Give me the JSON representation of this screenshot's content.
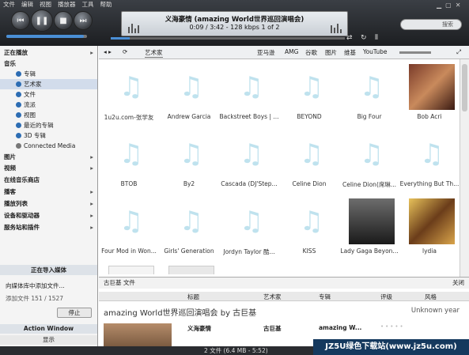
{
  "menu": [
    "文件",
    "编辑",
    "视图",
    "播放器",
    "工具",
    "帮助"
  ],
  "now_playing": {
    "title": "义海豪情 (amazing World世界巡回演唱会)",
    "info": "0:09 / 3:42 - 128 kbps  1 of 2"
  },
  "search_placeholder": "搜索",
  "sidebar": {
    "now_playing": "正在播放",
    "music": "音乐",
    "music_items": [
      "专辑",
      "艺术家",
      "文件",
      "流派",
      "视图",
      "最近的专辑",
      "3D 专辑",
      "Connected Media"
    ],
    "sections": [
      "图片",
      "视频",
      "在线音乐商店",
      "播客",
      "播放列表",
      "设备和驱动器",
      "服务站和插件"
    ],
    "importing": "正在导入媒体",
    "import_msg": "向媒体库中添加文件...",
    "import_count": "添加文件 151 / 1527",
    "stop": "停止",
    "action_window": "Action Window",
    "show": "显示"
  },
  "toolbar": {
    "view": "艺术家",
    "links": [
      "亚马逊",
      "AMG",
      "谷歌",
      "图片",
      "维基",
      "YouTube"
    ]
  },
  "artists": [
    "1u2u.com-张学友",
    "Andrew Garcia",
    "Backstreet Boys | ...",
    "BEYOND",
    "Big Four",
    "Bob Acri",
    "BTOB",
    "By2",
    "Cascada (DJ'Step...",
    "Celine Dion",
    "Celine Dion(席琳...",
    "Everything But Th...",
    "Four Mod in Won...",
    "Girls' Generation",
    "Jordyn Taylor 酷...",
    "KISS",
    "Lady Gaga Beyon...",
    "lydia",
    "",
    ""
  ],
  "detail": {
    "path": "古巨基  文件",
    "close": "关闭",
    "cols": [
      "标题",
      "艺术家",
      "专辑",
      "评级",
      "风格"
    ],
    "album_title": "amazing World世界巡回演唱会 by 古巨基",
    "year": "Unknown year",
    "row": {
      "title": "义海豪情",
      "artist": "古巨基",
      "album": "amazing W..."
    }
  },
  "status": "2 文件 (6.4 MB - 5:52)",
  "watermark": "JZ5U绿色下载站(www.jz5u.com)"
}
